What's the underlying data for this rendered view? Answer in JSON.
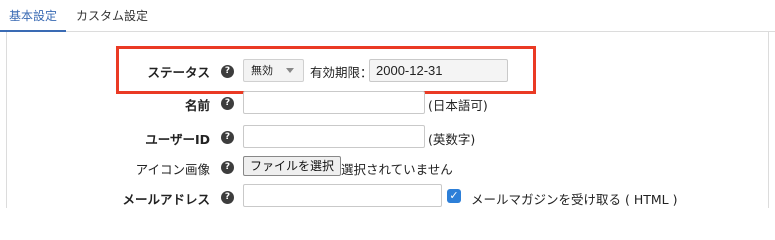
{
  "tabs": [
    {
      "label": "基本設定"
    },
    {
      "label": "カスタム設定"
    }
  ],
  "help_symbol": "?",
  "status": {
    "label": "ステータス",
    "select_value": "無効",
    "expiry_label": "有効期限：",
    "expiry_value": "2000-12-31"
  },
  "name": {
    "label": "名前",
    "value": "",
    "hint": "(日本語可)"
  },
  "user_id": {
    "label": "ユーザーID",
    "value": "",
    "hint": "(英数字)"
  },
  "icon_image": {
    "label": "アイコン画像",
    "button_label": "ファイルを選択",
    "status_text": "選択されていません"
  },
  "email": {
    "label": "メールアドレス",
    "value": "",
    "checkbox_checked": true,
    "checkbox_label": "メールマガジンを受け取る ( HTML )"
  },
  "colors": {
    "accent": "#3a6bb4",
    "highlight": "#ea3a24",
    "checkbox": "#2d7fd8"
  }
}
